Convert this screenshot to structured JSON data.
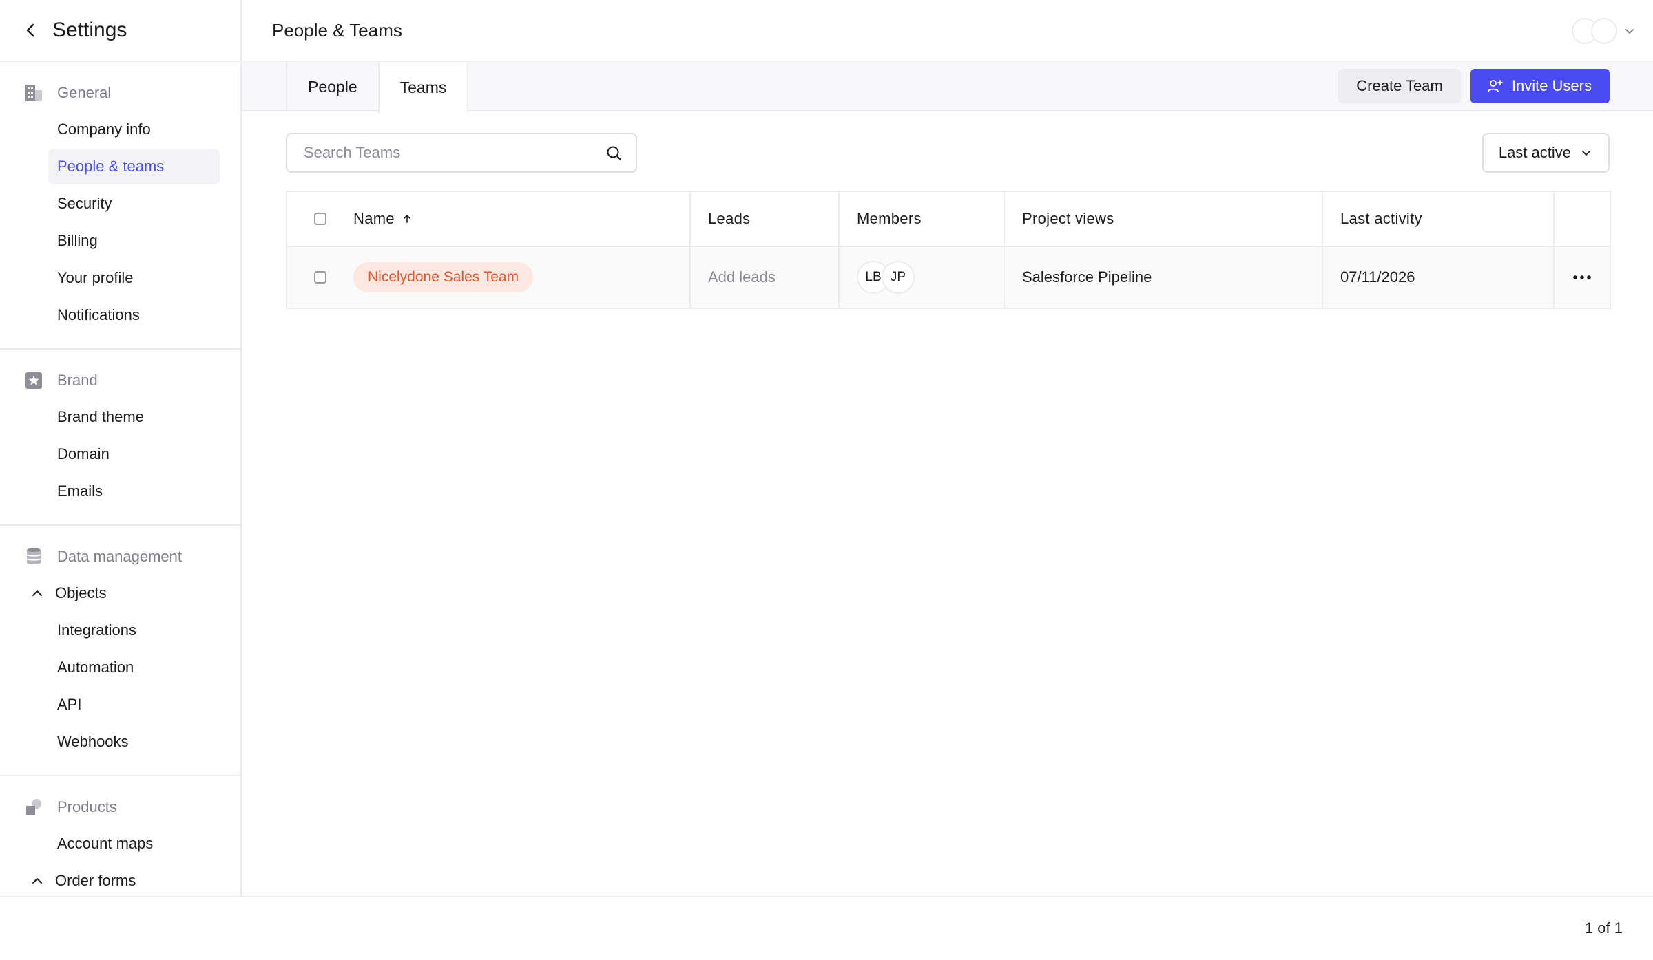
{
  "sidebar": {
    "title": "Settings",
    "sections": [
      {
        "group": "General",
        "icon": "building-icon",
        "items": [
          "Company info",
          "People & teams",
          "Security",
          "Billing",
          "Your profile",
          "Notifications"
        ]
      },
      {
        "group": "Brand",
        "icon": "star-icon",
        "items": [
          "Brand theme",
          "Domain",
          "Emails"
        ]
      },
      {
        "group": "Data management",
        "icon": "database-icon",
        "objects_label": "Objects",
        "items": [
          "Integrations",
          "Automation",
          "API",
          "Webhooks"
        ]
      },
      {
        "group": "Products",
        "icon": "products-icon",
        "items": [
          "Account maps"
        ],
        "order_forms_label": "Order forms"
      }
    ],
    "active_item": "People & teams"
  },
  "header": {
    "title": "People & Teams"
  },
  "tabs": [
    {
      "label": "People",
      "active": false
    },
    {
      "label": "Teams",
      "active": true
    }
  ],
  "actions": {
    "create_team": "Create Team",
    "invite_users": "Invite Users"
  },
  "search": {
    "placeholder": "Search Teams",
    "value": ""
  },
  "sort": {
    "label": "Last active"
  },
  "table": {
    "columns": [
      "Name",
      "Leads",
      "Members",
      "Project views",
      "Last activity"
    ],
    "rows": [
      {
        "name": "Nicelydone Sales Team",
        "leads": "Add leads",
        "members": [
          "LB",
          "JP"
        ],
        "project_views": "Salesforce Pipeline",
        "last_activity": "07/11/2026"
      }
    ]
  },
  "pagination": {
    "label": "1 of 1"
  },
  "colors": {
    "accent": "#4a4cf2",
    "team_pill_bg": "#fde8e1",
    "team_pill_text": "#e0572f"
  }
}
